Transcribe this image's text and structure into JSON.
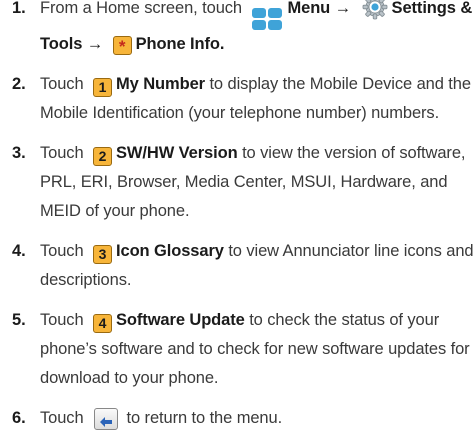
{
  "steps": [
    {
      "num": "1.",
      "parts": {
        "t1": "From a Home screen, touch",
        "menu": "Menu",
        "arrow1": "→",
        "settings": "Settings & Tools",
        "arrow2": "→",
        "key": "*",
        "phone_info": "Phone Info",
        "end": "."
      }
    },
    {
      "num": "2.",
      "pre": "Touch",
      "key": "1",
      "label": "My Number",
      "text": "to display the Mobile Device and the Mobile Identification (your telephone number) numbers."
    },
    {
      "num": "3.",
      "pre": "Touch",
      "key": "2",
      "label": "SW/HW Version",
      "text": "to view the version of software, PRL, ERI, Browser, Media Center, MSUI, Hardware, and MEID of your phone."
    },
    {
      "num": "4.",
      "pre": "Touch",
      "key": "3",
      "label": "Icon Glossary",
      "text": "to view Annunciator line icons and descriptions."
    },
    {
      "num": "5.",
      "pre": "Touch",
      "key": "4",
      "label": "Software Update",
      "text": "to check the status of your phone’s software and to check for new software updates for download to your phone."
    },
    {
      "num": "6.",
      "pre": "Touch",
      "text": "to return to the menu."
    }
  ],
  "icons": {
    "menu": "menu-grid-icon",
    "settings": "settings-gear-icon",
    "back": "back-arrow-icon"
  },
  "colors": {
    "key_fill": "#f7b53a",
    "menu_icon": "#3fa3d8",
    "star": "#c4291d"
  }
}
